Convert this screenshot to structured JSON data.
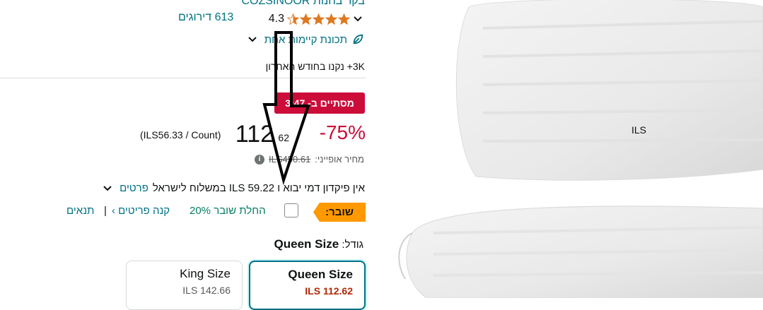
{
  "store": {
    "link_text": "בקר בחנות COZSINOOR"
  },
  "rating": {
    "value": "4.3",
    "stars": 4.3,
    "reviews_text": "613 דירוגים"
  },
  "sustainability": {
    "text": "תכונת קיימות אחת"
  },
  "bought": {
    "text": "3K+ נקנו בחודש האחרון"
  },
  "deal": {
    "badge": "מסתיים ב- 3:47"
  },
  "price": {
    "discount": "-75%",
    "currency": "ILS",
    "whole": "112",
    "fraction": "62",
    "per_unit": "(ILS56.33 / Count)",
    "list_label": "מחיר אופייני:",
    "list_value": "ILS450.61",
    "info_icon": "i"
  },
  "shipping": {
    "text": "אין פיקדון דמי יבוא ו ILS 59.22 במשלוח לישראל",
    "details_link": "פרטים"
  },
  "coupon": {
    "badge": "שובר:",
    "apply_text": "החלת שובר 20%",
    "shop_link": "קנה פריטים ›",
    "separator": "|",
    "terms_link": "תנאים"
  },
  "size": {
    "label": "גודל:",
    "selected": "Queen Size",
    "options": [
      {
        "name": "Queen Size",
        "price": "ILS 112.62",
        "selected": true
      },
      {
        "name": "King Size",
        "price": "ILS 142.66",
        "selected": false
      }
    ]
  },
  "colors": {
    "link": "#007185",
    "deal": "#cc0c39",
    "coupon": "#ff9900",
    "coupon_text": "#067d62",
    "star": "#de7921"
  }
}
